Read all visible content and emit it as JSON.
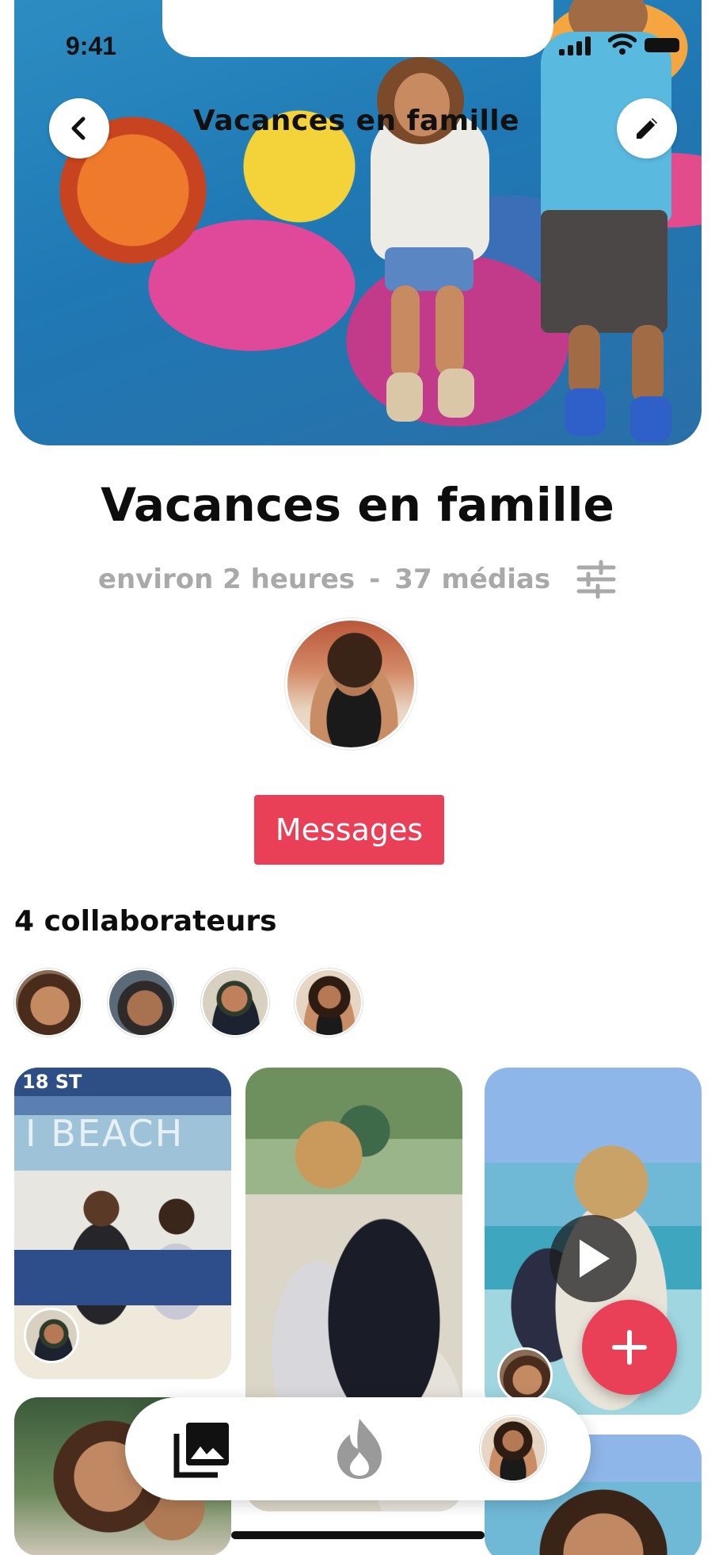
{
  "status_bar": {
    "time": "9:41"
  },
  "header": {
    "title": "Vacances en famille",
    "back_icon": "chevron-left-icon",
    "edit_icon": "pencil-icon"
  },
  "album": {
    "title": "Vacances en famille",
    "duration": "environ 2 heures",
    "separator": "-",
    "media_count": "37 médias",
    "filter_icon": "sliders-icon"
  },
  "messages_button": {
    "label": "Messages"
  },
  "collaborators": {
    "title": "4 collaborateurs",
    "count": 4
  },
  "photo_grid": {
    "photo1_sign": "18 ST",
    "photo1_banner": "I BEACH"
  },
  "fab": {
    "icon": "plus-icon"
  },
  "bottom_nav": {
    "items": [
      "gallery-icon",
      "flame-icon",
      "profile-avatar"
    ]
  },
  "colors": {
    "accent": "#e94058",
    "meta_text": "#a9a9a9"
  }
}
